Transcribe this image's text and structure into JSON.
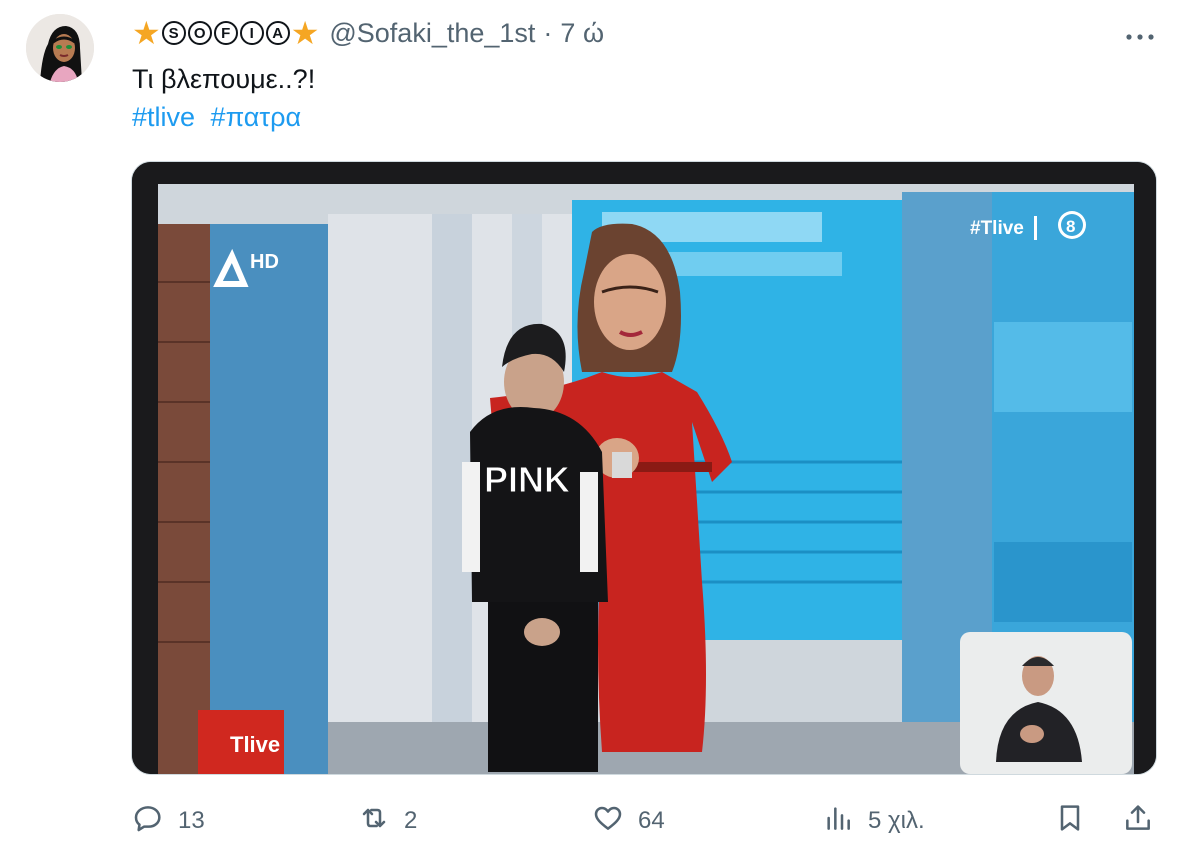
{
  "tweet": {
    "display_name_parts": [
      "S",
      "O",
      "F",
      "I",
      "A"
    ],
    "handle": "@Sofaki_the_1st",
    "separator": "·",
    "time": "7 ώ",
    "more_icon": "more-horizontal-icon",
    "text": "Τι βλεπουμε..?!",
    "hashtags": [
      "#tlive",
      "#πατρα"
    ]
  },
  "media": {
    "alt": "TV screen showing a presenter in a red dress with a boy in a black PINK hoodie",
    "channel_logo": "HD",
    "tv_tag": "#Tlive",
    "tv_rating": "8",
    "studio_sign": "Tlive",
    "hoodie_text": "PINK"
  },
  "actions": {
    "reply": {
      "icon": "reply-icon",
      "count": "13"
    },
    "retweet": {
      "icon": "retweet-icon",
      "count": "2"
    },
    "like": {
      "icon": "heart-icon",
      "count": "64"
    },
    "views": {
      "icon": "views-icon",
      "count": "5 χιλ."
    },
    "bookmark": {
      "icon": "bookmark-icon"
    },
    "share": {
      "icon": "share-icon"
    }
  },
  "colors": {
    "accent": "#1d9bf0",
    "muted": "#536471",
    "star": "#f5a623",
    "text": "#0f1419"
  }
}
